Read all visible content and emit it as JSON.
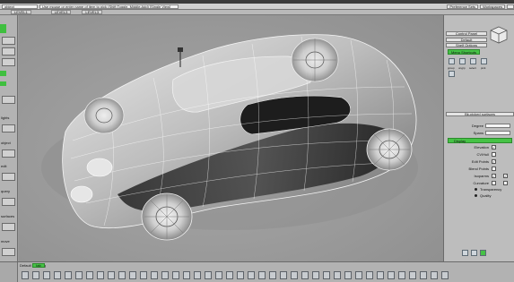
{
  "titlebar": {
    "mode_field": "object",
    "prompt_text": "Use mouse or enter name of item to pick (Shift:Toggle, Middle:Add) [Single View]",
    "pref_button": "Preference Sets",
    "workspace_label": "Workspaces"
  },
  "statusline": {
    "tabs": [
      "LEVEL1",
      "LEVEL3",
      "LEVEL3"
    ]
  },
  "left_strip": {
    "labels": [
      "lights",
      "object",
      "edit",
      "query",
      "surfaces",
      "move"
    ]
  },
  "right_panel": {
    "control_panel_label": "Control Panel",
    "default_label": "Default",
    "shelf_options_label": "Shelf Options",
    "menu_shortcuts_label": "Menu Shortcuts",
    "shelf_items": [
      "group",
      "ungrp",
      "select",
      "pick"
    ],
    "object_type_label": "Bk-picked surfaces",
    "degree_label": "Degree",
    "spans_label": "Spans",
    "display_section": "Display",
    "display_options": [
      {
        "label": "Elevation",
        "checked": true
      },
      {
        "label": "CV/Hull",
        "checked": false
      },
      {
        "label": "Edit Points",
        "checked": true
      },
      {
        "label": "Blend Points",
        "checked": false
      },
      {
        "label": "Isoparms",
        "checked": true
      },
      {
        "label": "Curvature",
        "checked": false
      }
    ],
    "radio_options": [
      "Transparency",
      "Quality"
    ]
  },
  "bottom_shelf": {
    "title": "Default Shelving",
    "tab_label": "tab"
  },
  "colors": {
    "accent_green": "#46c246",
    "viewport_gray": "#9a9a9a",
    "panel_gray": "#bdbdbd"
  }
}
